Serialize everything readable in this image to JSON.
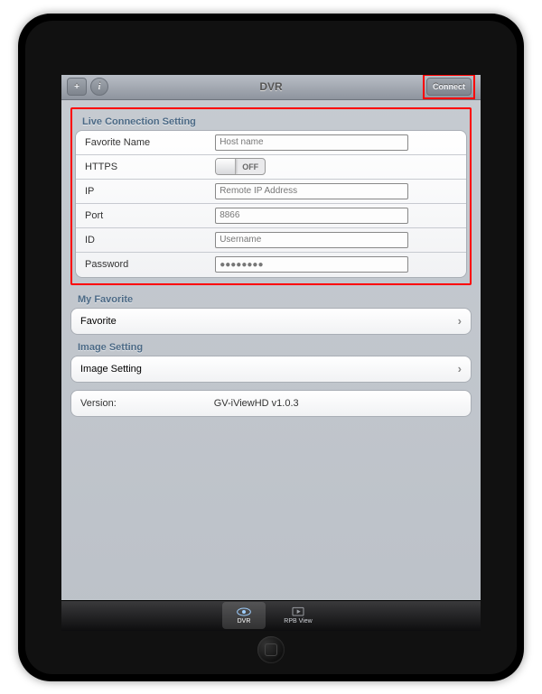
{
  "navbar": {
    "title": "DVR",
    "add_label": "+",
    "info_label": "i",
    "connect_label": "Connect"
  },
  "sections": {
    "live_header": "Live Connection Setting",
    "myfav_header": "My Favorite",
    "image_header": "Image Setting"
  },
  "fields": {
    "favorite_name": {
      "label": "Favorite Name",
      "value": "Host name"
    },
    "https": {
      "label": "HTTPS",
      "state": "OFF"
    },
    "ip": {
      "label": "IP",
      "value": "Remote IP Address"
    },
    "port": {
      "label": "Port",
      "value": "8866"
    },
    "id": {
      "label": "ID",
      "value": "Username"
    },
    "password": {
      "label": "Password",
      "value": "●●●●●●●●"
    }
  },
  "favorite_row": {
    "label": "Favorite"
  },
  "image_row": {
    "label": "Image Setting"
  },
  "version": {
    "label": "Version:",
    "value": "GV-iViewHD v1.0.3"
  },
  "tabs": {
    "dvr": "DVR",
    "rpb": "RPB View"
  }
}
